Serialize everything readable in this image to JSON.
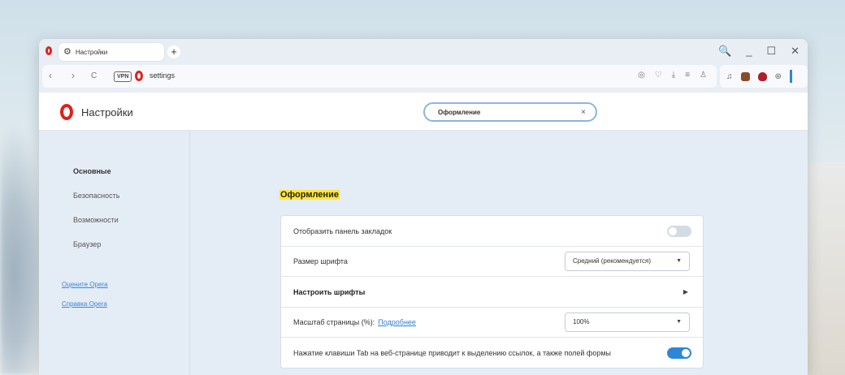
{
  "browser": {
    "tab_title": "Настройки",
    "new_tab": "+",
    "window_controls": [
      "🔍",
      "_",
      "☐",
      "✕"
    ],
    "vpn": "VPN",
    "url": "settings",
    "nav": {
      "back": "‹",
      "forward": "›",
      "reload": "C"
    },
    "address_icons": [
      "camera-icon",
      "heart-icon",
      "download-icon",
      "menu-icon",
      "user-icon"
    ]
  },
  "header": {
    "title": "Настройки",
    "search_value": "Оформление",
    "search_clear": "×"
  },
  "sidebar": {
    "items": [
      {
        "label": "Основные",
        "active": true
      },
      {
        "label": "Безопасность",
        "active": false
      },
      {
        "label": "Возможности",
        "active": false
      },
      {
        "label": "Браузер",
        "active": false
      }
    ],
    "links": [
      "Оцените Opera",
      "Справка Opera"
    ]
  },
  "section": {
    "title": "Оформление",
    "rows": {
      "bookmarks": {
        "label": "Отобразить панель закладок",
        "enabled": false
      },
      "font_size": {
        "label": "Размер шрифта",
        "value": "Средний (рекомендуется)"
      },
      "customize_fonts": {
        "label": "Настроить шрифты"
      },
      "page_zoom": {
        "label": "Масштаб страницы (%):",
        "link": "Подробнее",
        "value": "100%"
      },
      "tab_highlight": {
        "label": "Нажатие клавиши Tab на веб-странице приводит к выделению ссылок, а также полей формы",
        "enabled": true
      }
    }
  },
  "colors": {
    "accent": "#2e86d6",
    "highlight": "#ffe73a",
    "opera_red": "#e0201b"
  }
}
